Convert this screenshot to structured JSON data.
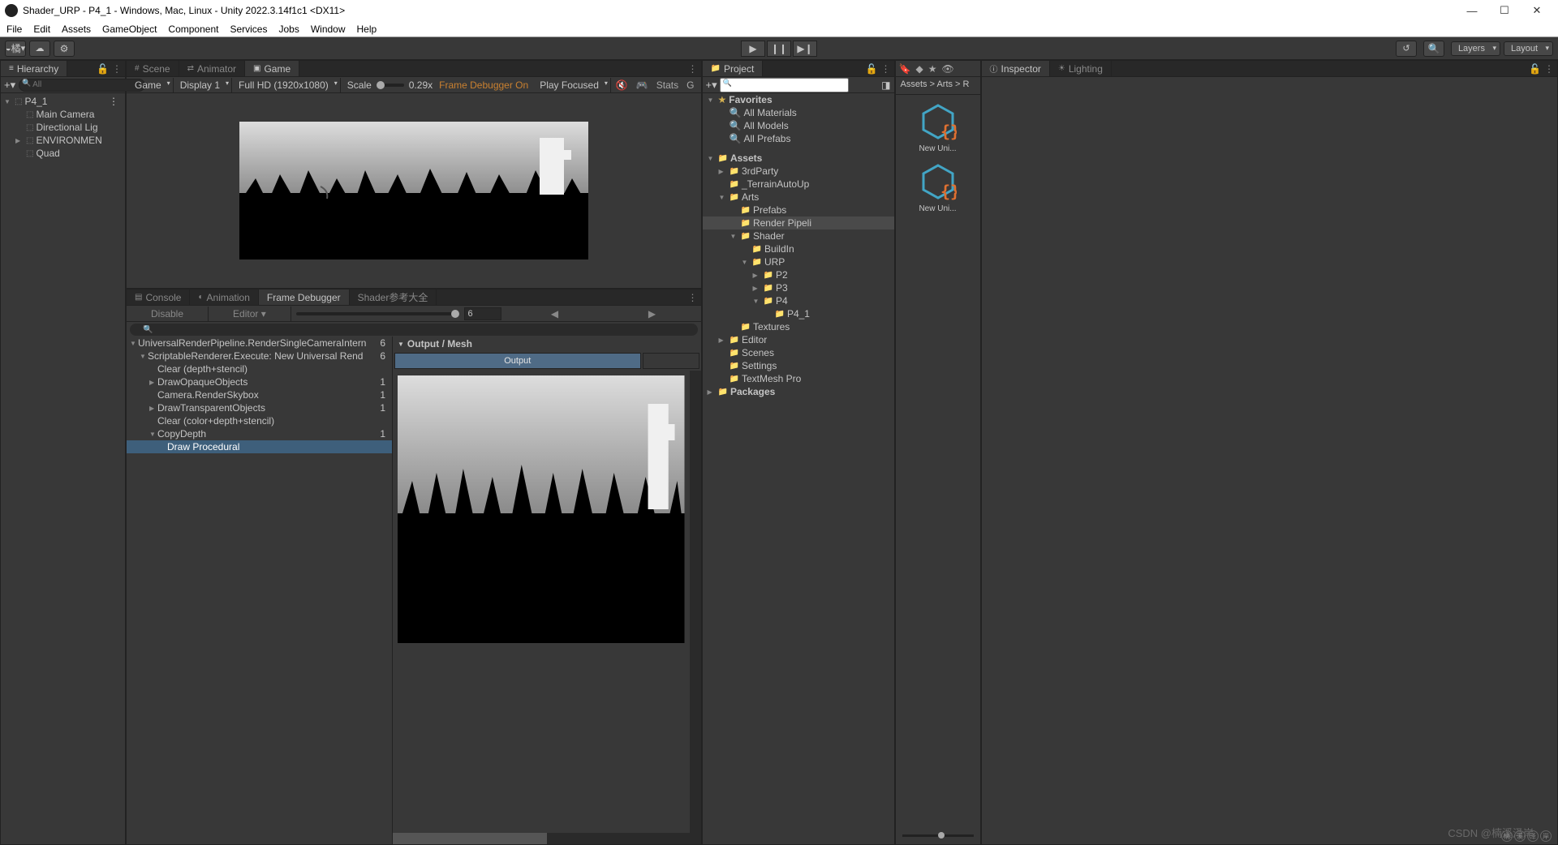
{
  "window": {
    "title": "Shader_URP - P4_1 - Windows, Mac, Linux - Unity 2022.3.14f1c1 <DX11>"
  },
  "menu": [
    "File",
    "Edit",
    "Assets",
    "GameObject",
    "Component",
    "Services",
    "Jobs",
    "Window",
    "Help"
  ],
  "toolbar": {
    "account_label": "橘",
    "layers": "Layers",
    "layout": "Layout"
  },
  "hierarchy": {
    "tab": "Hierarchy",
    "search_placeholder": "All",
    "root": "P4_1",
    "items": [
      "Main Camera",
      "Directional Lig",
      "ENVIRONMEN",
      "Quad"
    ]
  },
  "gameTabs": {
    "scene": "Scene",
    "animator": "Animator",
    "game": "Game"
  },
  "gameBar": {
    "mode": "Game",
    "display": "Display 1",
    "resolution": "Full HD (1920x1080)",
    "scale_label": "Scale",
    "scale_value": "0.29x",
    "frame_debugger": "Frame Debugger On",
    "play_focused": "Play Focused",
    "stats": "Stats",
    "gizmos_initial": "G"
  },
  "bottomTabs": {
    "console": "Console",
    "animation": "Animation",
    "frame_debugger": "Frame Debugger",
    "shader_ref": "Shader参考大全"
  },
  "frameDebugger": {
    "disable": "Disable",
    "editor": "Editor",
    "count": "6",
    "tree": [
      {
        "label": "UniversalRenderPipeline.RenderSingleCameraIntern",
        "count": "6",
        "depth": 0,
        "arrow": "▼"
      },
      {
        "label": "ScriptableRenderer.Execute: New Universal Rend",
        "count": "6",
        "depth": 1,
        "arrow": "▼"
      },
      {
        "label": "Clear (depth+stencil)",
        "count": "",
        "depth": 2,
        "arrow": ""
      },
      {
        "label": "DrawOpaqueObjects",
        "count": "1",
        "depth": 2,
        "arrow": "▶"
      },
      {
        "label": "Camera.RenderSkybox",
        "count": "1",
        "depth": 2,
        "arrow": ""
      },
      {
        "label": "DrawTransparentObjects",
        "count": "1",
        "depth": 2,
        "arrow": "▶"
      },
      {
        "label": "Clear (color+depth+stencil)",
        "count": "",
        "depth": 2,
        "arrow": ""
      },
      {
        "label": "CopyDepth",
        "count": "1",
        "depth": 2,
        "arrow": "▼"
      },
      {
        "label": "Draw Procedural",
        "count": "",
        "depth": 3,
        "arrow": "",
        "sel": true
      }
    ],
    "output_header": "Output / Mesh",
    "output_btn": "Output"
  },
  "project": {
    "tab": "Project",
    "favorites": "Favorites",
    "fav_items": [
      "All Materials",
      "All Models",
      "All Prefabs"
    ],
    "tree": [
      {
        "label": "Assets",
        "depth": 0,
        "arrow": "▼",
        "ico": "📁",
        "bold": true
      },
      {
        "label": "3rdParty",
        "depth": 1,
        "arrow": "▶",
        "ico": "📁"
      },
      {
        "label": "_TerrainAutoUp",
        "depth": 1,
        "arrow": "",
        "ico": "📁"
      },
      {
        "label": "Arts",
        "depth": 1,
        "arrow": "▼",
        "ico": "📁"
      },
      {
        "label": "Prefabs",
        "depth": 2,
        "arrow": "",
        "ico": "📁"
      },
      {
        "label": "Render Pipeli",
        "depth": 2,
        "arrow": "",
        "ico": "📁",
        "sel": true
      },
      {
        "label": "Shader",
        "depth": 2,
        "arrow": "▼",
        "ico": "📁"
      },
      {
        "label": "BuildIn",
        "depth": 3,
        "arrow": "",
        "ico": "📁"
      },
      {
        "label": "URP",
        "depth": 3,
        "arrow": "▼",
        "ico": "📁"
      },
      {
        "label": "P2",
        "depth": 4,
        "arrow": "▶",
        "ico": "📁"
      },
      {
        "label": "P3",
        "depth": 4,
        "arrow": "▶",
        "ico": "📁"
      },
      {
        "label": "P4",
        "depth": 4,
        "arrow": "▼",
        "ico": "📁"
      },
      {
        "label": "P4_1",
        "depth": 5,
        "arrow": "",
        "ico": "📁"
      },
      {
        "label": "Textures",
        "depth": 2,
        "arrow": "",
        "ico": "📁"
      },
      {
        "label": "Editor",
        "depth": 1,
        "arrow": "▶",
        "ico": "📁"
      },
      {
        "label": "Scenes",
        "depth": 1,
        "arrow": "",
        "ico": "📁"
      },
      {
        "label": "Settings",
        "depth": 1,
        "arrow": "",
        "ico": "📁"
      },
      {
        "label": "TextMesh Pro",
        "depth": 1,
        "arrow": "",
        "ico": "📁"
      },
      {
        "label": "Packages",
        "depth": 0,
        "arrow": "▶",
        "ico": "📁",
        "bold": true
      }
    ]
  },
  "assets": {
    "breadcrumb": "Assets > Arts > R",
    "items": [
      "New Uni...",
      "New Uni..."
    ]
  },
  "inspector": {
    "tab": "Inspector",
    "lighting": "Lighting"
  },
  "watermark": "CSDN @楠溪泽岸"
}
